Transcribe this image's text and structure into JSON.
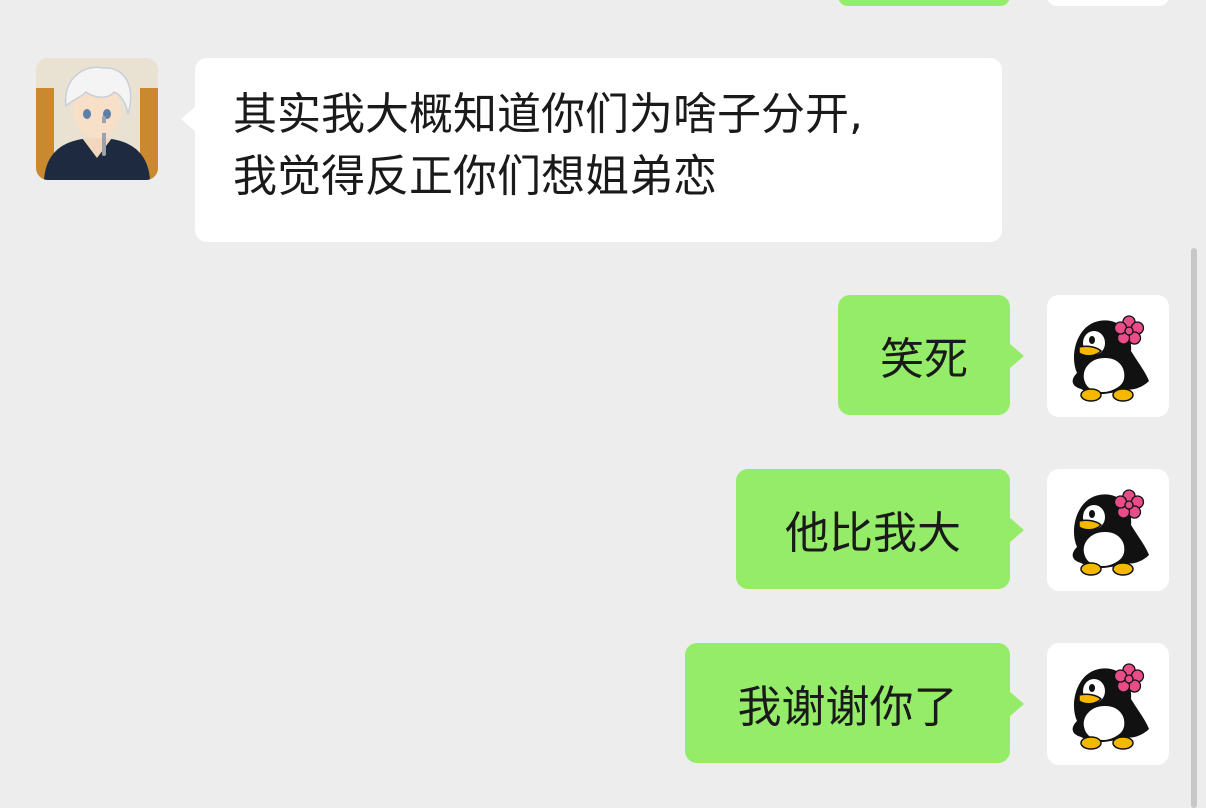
{
  "chat": {
    "messages": [
      {
        "sender": "contact",
        "lines": [
          "其实我大概知道你们为啥子分开,",
          "我觉得反正你们想姐弟恋"
        ]
      },
      {
        "sender": "me",
        "text": "笑死"
      },
      {
        "sender": "me",
        "text": "他比我大"
      },
      {
        "sender": "me",
        "text": "我谢谢你了"
      }
    ]
  },
  "avatars": {
    "contact_icon": "anime-boy-avatar",
    "me_icon": "penguin-with-flower-avatar"
  },
  "colors": {
    "background": "#ededed",
    "incoming_bubble": "#ffffff",
    "outgoing_bubble": "#95ec69",
    "text": "#1a1a1a"
  }
}
